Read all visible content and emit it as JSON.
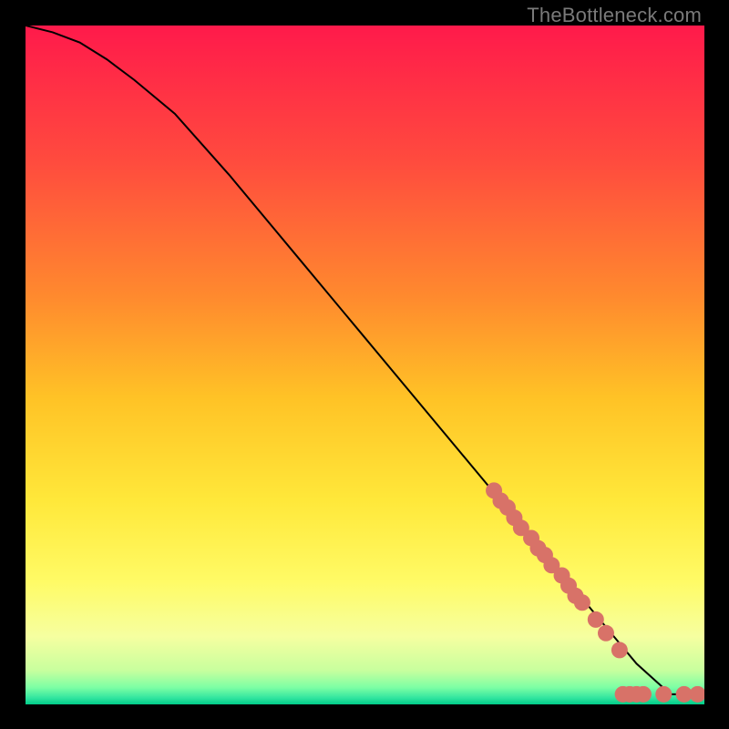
{
  "attribution": "TheBottleneck.com",
  "chart_data": {
    "type": "line",
    "title": "",
    "xlabel": "",
    "ylabel": "",
    "xlim": [
      0,
      100
    ],
    "ylim": [
      0,
      100
    ],
    "grid": false,
    "legend": false,
    "background_gradient": {
      "stops": [
        {
          "offset": 0.0,
          "color": "#ff1a4b"
        },
        {
          "offset": 0.2,
          "color": "#ff4b3e"
        },
        {
          "offset": 0.4,
          "color": "#ff8a2e"
        },
        {
          "offset": 0.55,
          "color": "#ffc326"
        },
        {
          "offset": 0.7,
          "color": "#ffe83a"
        },
        {
          "offset": 0.82,
          "color": "#fffb66"
        },
        {
          "offset": 0.9,
          "color": "#f6ffa0"
        },
        {
          "offset": 0.95,
          "color": "#c8ff9e"
        },
        {
          "offset": 0.975,
          "color": "#7dffa4"
        },
        {
          "offset": 0.99,
          "color": "#34e6a0"
        },
        {
          "offset": 1.0,
          "color": "#00cc88"
        }
      ]
    },
    "series": [
      {
        "name": "curve",
        "type": "line",
        "color": "#000000",
        "width": 2,
        "x": [
          0,
          4,
          8,
          12,
          16,
          22,
          30,
          40,
          50,
          60,
          70,
          80,
          85,
          90,
          95,
          100
        ],
        "y": [
          100,
          99,
          97.5,
          95,
          92,
          87,
          78,
          66,
          54,
          42,
          30,
          18,
          12,
          6,
          1.5,
          1.5
        ]
      },
      {
        "name": "curve-markers",
        "type": "scatter",
        "color": "#d87268",
        "size": 9,
        "x": [
          69,
          70,
          71,
          72,
          73,
          74.5,
          75.5,
          76.5,
          77.5,
          79,
          80,
          81,
          82,
          84,
          85.5,
          87.5
        ],
        "y": [
          31.5,
          30,
          29,
          27.5,
          26,
          24.5,
          23,
          22,
          20.5,
          19,
          17.5,
          16,
          15,
          12.5,
          10.5,
          8
        ]
      },
      {
        "name": "baseline-markers",
        "type": "scatter",
        "color": "#d87268",
        "size": 9,
        "x": [
          88,
          89,
          90,
          91,
          94,
          97,
          99
        ],
        "y": [
          1.5,
          1.5,
          1.5,
          1.5,
          1.5,
          1.5,
          1.5
        ]
      }
    ]
  }
}
